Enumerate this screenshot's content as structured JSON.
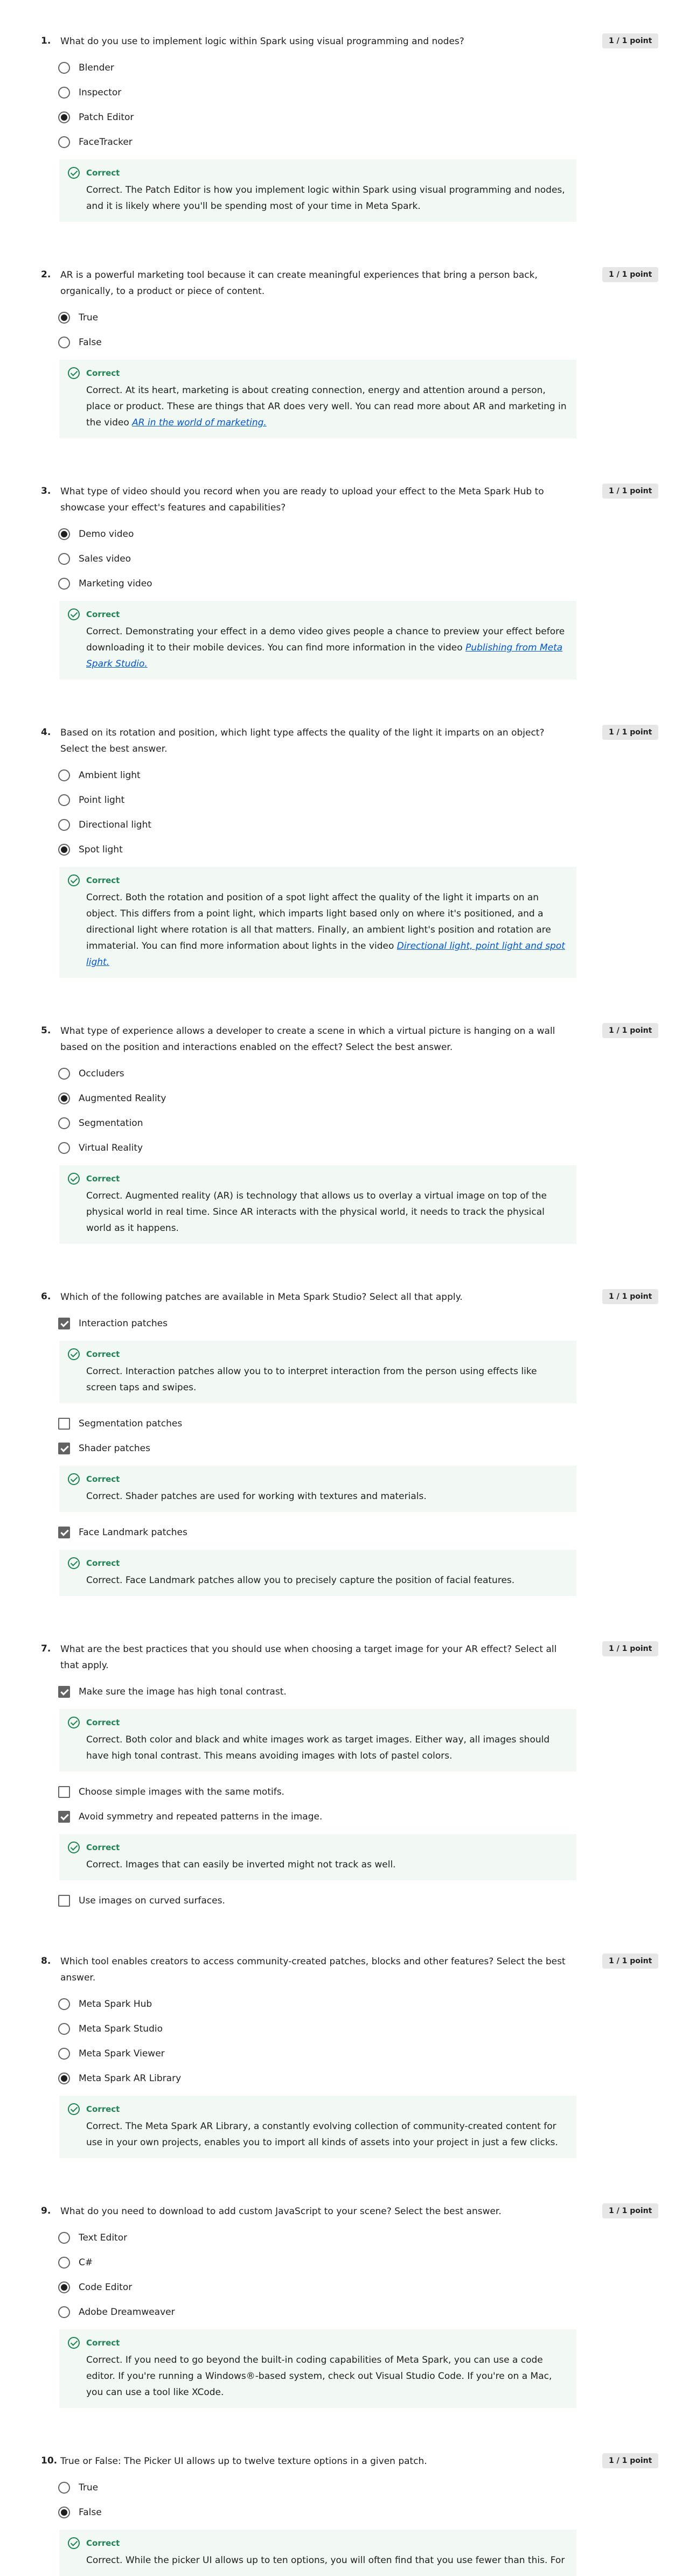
{
  "questions": [
    {
      "number": "1.",
      "text": "What do you use to implement logic within Spark using visual programming and nodes?",
      "points": "1 / 1 point",
      "type": "radio",
      "options": [
        {
          "label": "Blender",
          "checked": false
        },
        {
          "label": "Inspector",
          "checked": false
        },
        {
          "label": "Patch Editor",
          "checked": true
        },
        {
          "label": "FaceTracker",
          "checked": false
        }
      ],
      "feedback": {
        "after": 3,
        "title": "Correct",
        "text": "Correct. The Patch Editor is how you implement logic within Spark using visual programming and nodes, and it is likely where you'll be spending most of your time in Meta Spark."
      }
    },
    {
      "number": "2.",
      "text": "AR is a powerful marketing tool because it can create meaningful experiences that bring a person back, organically, to a product or piece of content.",
      "points": "1 / 1 point",
      "type": "radio",
      "options": [
        {
          "label": "True",
          "checked": true
        },
        {
          "label": "False",
          "checked": false
        }
      ],
      "feedback": {
        "after": 1,
        "title": "Correct",
        "text": "Correct. At its heart, marketing is about creating connection, energy and attention around a person, place or product. These are things that AR does very well. You can read more about AR and marketing in the video ",
        "link": "AR in the world of marketing."
      }
    },
    {
      "number": "3.",
      "text": "What type of video should you record when you are ready to upload your effect to the Meta Spark Hub to showcase your effect's features and capabilities?",
      "points": "1 / 1 point",
      "type": "radio",
      "options": [
        {
          "label": "Demo video",
          "checked": true
        },
        {
          "label": "Sales video",
          "checked": false
        },
        {
          "label": "Marketing video",
          "checked": false
        }
      ],
      "feedback": {
        "after": 2,
        "title": "Correct",
        "text": "Correct. Demonstrating your effect in a demo video gives people a chance to preview your effect before downloading it to their mobile devices. You can find more information in the video ",
        "link": "Publishing from Meta Spark Studio."
      }
    },
    {
      "number": "4.",
      "text": "Based on its rotation and position, which light type affects the quality of the light it imparts on an object? Select the best answer.",
      "points": "1 / 1 point",
      "type": "radio",
      "options": [
        {
          "label": "Ambient light",
          "checked": false
        },
        {
          "label": "Point light",
          "checked": false
        },
        {
          "label": "Directional light",
          "checked": false
        },
        {
          "label": "Spot light",
          "checked": true
        }
      ],
      "feedback": {
        "after": 3,
        "title": "Correct",
        "text": "Correct. Both the rotation and position of a spot light affect the quality of the light it imparts on an object. This differs from a point light, which imparts light based only on where it's positioned, and a directional light where rotation is all that matters. Finally, an ambient light's position and rotation are immaterial. You can find more information about lights in the video ",
        "link": "Directional light, point light and spot light."
      }
    },
    {
      "number": "5.",
      "text": "What type of experience allows a developer to create a scene in which a virtual picture is hanging on a wall based on the position and interactions enabled on the effect? Select the best answer.",
      "points": "1 / 1 point",
      "type": "radio",
      "options": [
        {
          "label": "Occluders",
          "checked": false
        },
        {
          "label": "Augmented Reality",
          "checked": true
        },
        {
          "label": "Segmentation",
          "checked": false
        },
        {
          "label": "Virtual Reality",
          "checked": false
        }
      ],
      "feedback": {
        "after": 3,
        "title": "Correct",
        "text": "Correct. Augmented reality (AR) is technology that allows us to overlay a virtual image on top of the physical world in real time. Since AR interacts with the physical world, it needs to track the physical world as it happens."
      }
    },
    {
      "number": "6.",
      "text": "Which of the following patches are available in Meta Spark Studio? Select all that apply.",
      "points": "1 / 1 point",
      "type": "checkbox",
      "options": [
        {
          "label": "Interaction patches",
          "checked": true,
          "feedback": {
            "title": "Correct",
            "text": "Correct. Interaction patches allow you to to interpret interaction from the person using effects like screen taps and swipes."
          }
        },
        {
          "label": "Segmentation patches",
          "checked": false
        },
        {
          "label": "Shader patches",
          "checked": true,
          "feedback": {
            "title": "Correct",
            "text": "Correct. Shader patches are used for working with textures and materials."
          }
        },
        {
          "label": "Face Landmark patches",
          "checked": true,
          "feedback": {
            "title": "Correct",
            "text": "Correct. Face Landmark patches allow you to precisely capture the position of facial features."
          }
        }
      ]
    },
    {
      "number": "7.",
      "text": "What are the best practices that you should use when choosing a target image for your AR effect? Select all that apply.",
      "points": "1 / 1 point",
      "type": "checkbox",
      "options": [
        {
          "label": "Make sure the image has high tonal contrast.",
          "checked": true,
          "feedback": {
            "title": "Correct",
            "text": "Correct. Both color and black and white images work as target images. Either way, all images should have high tonal contrast. This means avoiding images with lots of pastel colors."
          }
        },
        {
          "label": "Choose simple images with the same motifs.",
          "checked": false
        },
        {
          "label": "Avoid symmetry and repeated patterns in the image.",
          "checked": true,
          "feedback": {
            "title": "Correct",
            "text": "Correct. Images that can easily be inverted might not track as well."
          }
        },
        {
          "label": "Use images on curved surfaces.",
          "checked": false
        }
      ]
    },
    {
      "number": "8.",
      "text": "Which tool enables creators to access community-created patches, blocks and other features? Select the best answer.",
      "points": "1 / 1 point",
      "type": "radio",
      "options": [
        {
          "label": "Meta Spark Hub",
          "checked": false
        },
        {
          "label": "Meta Spark Studio",
          "checked": false
        },
        {
          "label": "Meta Spark Viewer",
          "checked": false
        },
        {
          "label": "Meta Spark AR Library",
          "checked": true
        }
      ],
      "feedback": {
        "after": 3,
        "title": "Correct",
        "text": "Correct. The Meta Spark AR Library, a constantly evolving collection of community-created content for use in your own projects, enables you to import all kinds of assets into your project in just a few clicks."
      }
    },
    {
      "number": "9.",
      "text": "What do you need to download to add custom JavaScript to your scene? Select the best answer.",
      "points": "1 / 1 point",
      "type": "radio",
      "options": [
        {
          "label": "Text Editor",
          "checked": false
        },
        {
          "label": "C#",
          "checked": false
        },
        {
          "label": "Code Editor",
          "checked": true
        },
        {
          "label": "Adobe Dreamweaver",
          "checked": false
        }
      ],
      "feedback": {
        "after": 3,
        "title": "Correct",
        "text": "Correct. If you need to go beyond the built-in coding capabilities of Meta Spark, you can use a code editor. If you're running a Windows®-based system, check out Visual Studio Code. If you're on a Mac, you can use a tool like XCode."
      }
    },
    {
      "number": "10.",
      "text": "True or False: The Picker UI allows up to twelve texture options in a given patch.",
      "points": "1 / 1 point",
      "type": "radio",
      "options": [
        {
          "label": "True",
          "checked": false
        },
        {
          "label": "False",
          "checked": true
        }
      ],
      "feedback": {
        "after": 1,
        "title": "Correct",
        "text": "Correct. While the picker UI allows up to ten options, you will often find that you use fewer than this. For"
      }
    }
  ]
}
